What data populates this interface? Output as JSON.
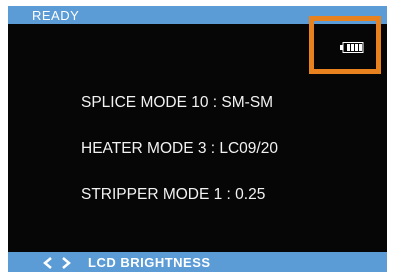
{
  "status_bar": {
    "text": "READY",
    "color": "#5b9bd6"
  },
  "battery": {
    "icon": "battery-icon",
    "level_fraction": 0.8
  },
  "settings": {
    "splice_mode": "SPLICE MODE 10 : SM-SM",
    "heater_mode": "HEATER MODE 3 : LC09/20",
    "stripper_mode": "STRIPPER MODE 1 : 0.25"
  },
  "footer": {
    "arrows_icon": "left-right-arrows-icon",
    "text": "LCD BRIGHTNESS"
  },
  "highlight": {
    "color": "#e8821f"
  }
}
